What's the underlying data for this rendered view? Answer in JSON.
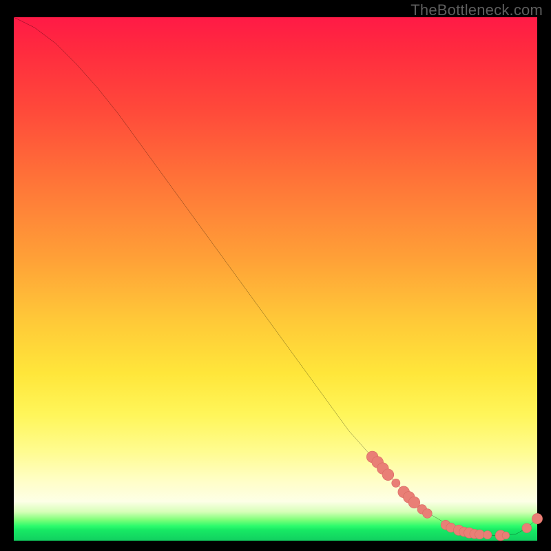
{
  "watermark": "TheBottleneck.com",
  "colors": {
    "curve_stroke": "#000000",
    "marker_fill": "#e97f76",
    "marker_stroke": "#d86b63",
    "background": "#000000"
  },
  "chart_data": {
    "type": "line",
    "title": "",
    "xlabel": "",
    "ylabel": "",
    "xlim": [
      0,
      100
    ],
    "ylim": [
      0,
      100
    ],
    "series": [
      {
        "name": "bottleneck-curve",
        "x": [
          0,
          4,
          8,
          12,
          16,
          20,
          24,
          28,
          32,
          36,
          40,
          44,
          48,
          52,
          56,
          60,
          64,
          68,
          70,
          72,
          74,
          76,
          78,
          80,
          82,
          84,
          86,
          88,
          90,
          92,
          94,
          96,
          98,
          100
        ],
        "y": [
          100,
          98,
          95,
          91,
          86.5,
          81.5,
          76,
          70.5,
          65,
          59.5,
          54,
          48.5,
          43,
          37.5,
          32,
          26.5,
          21,
          16.5,
          14,
          12,
          10,
          8,
          6.2,
          4.8,
          3.6,
          2.6,
          1.9,
          1.4,
          1.1,
          1.0,
          1.0,
          1.3,
          2.4,
          4.2
        ]
      }
    ],
    "markers": [
      {
        "x": 68.5,
        "y": 16.0,
        "r": 1.1
      },
      {
        "x": 69.5,
        "y": 15.0,
        "r": 1.1
      },
      {
        "x": 70.5,
        "y": 13.8,
        "r": 1.1
      },
      {
        "x": 71.5,
        "y": 12.6,
        "r": 1.1
      },
      {
        "x": 73.0,
        "y": 11.0,
        "r": 0.8
      },
      {
        "x": 74.5,
        "y": 9.3,
        "r": 1.1
      },
      {
        "x": 75.5,
        "y": 8.3,
        "r": 1.1
      },
      {
        "x": 76.5,
        "y": 7.3,
        "r": 1.1
      },
      {
        "x": 78.0,
        "y": 6.0,
        "r": 0.9
      },
      {
        "x": 79.0,
        "y": 5.2,
        "r": 0.9
      },
      {
        "x": 82.5,
        "y": 3.0,
        "r": 0.9
      },
      {
        "x": 83.5,
        "y": 2.5,
        "r": 0.9
      },
      {
        "x": 85.0,
        "y": 2.0,
        "r": 1.0
      },
      {
        "x": 86.0,
        "y": 1.7,
        "r": 0.9
      },
      {
        "x": 87.0,
        "y": 1.5,
        "r": 1.0
      },
      {
        "x": 88.0,
        "y": 1.3,
        "r": 0.9
      },
      {
        "x": 89.0,
        "y": 1.2,
        "r": 0.9
      },
      {
        "x": 90.5,
        "y": 1.1,
        "r": 0.8
      },
      {
        "x": 93.0,
        "y": 1.0,
        "r": 1.0
      },
      {
        "x": 94.0,
        "y": 1.0,
        "r": 0.7
      },
      {
        "x": 98.0,
        "y": 2.4,
        "r": 0.9
      },
      {
        "x": 100.0,
        "y": 4.2,
        "r": 1.0
      }
    ]
  }
}
